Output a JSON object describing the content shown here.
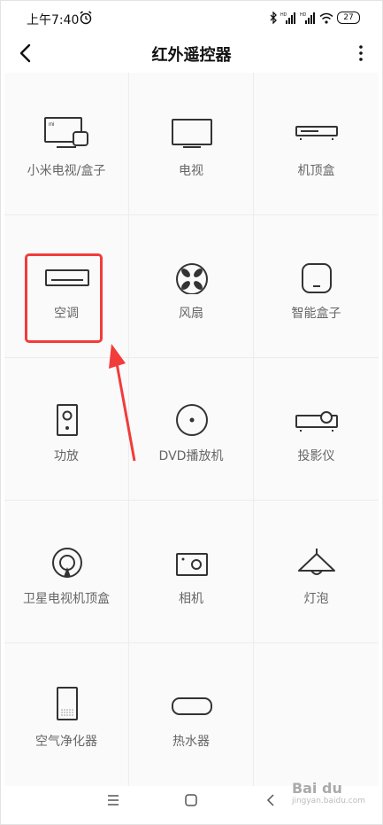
{
  "status_bar": {
    "time": "上午7:40",
    "battery": "27",
    "icons": [
      "alarm-icon",
      "bluetooth-icon",
      "hd-signal-icon",
      "hd-signal-icon",
      "wifi-icon",
      "battery-icon"
    ]
  },
  "header": {
    "title": "红外遥控器"
  },
  "devices": [
    {
      "label": "小米电视/盒子",
      "icon": "mi-tv-box-icon"
    },
    {
      "label": "电视",
      "icon": "tv-icon"
    },
    {
      "label": "机顶盒",
      "icon": "set-top-box-icon"
    },
    {
      "label": "空调",
      "icon": "air-conditioner-icon"
    },
    {
      "label": "风扇",
      "icon": "fan-icon"
    },
    {
      "label": "智能盒子",
      "icon": "smart-box-icon"
    },
    {
      "label": "功放",
      "icon": "amplifier-icon"
    },
    {
      "label": "DVD播放机",
      "icon": "dvd-player-icon"
    },
    {
      "label": "投影仪",
      "icon": "projector-icon"
    },
    {
      "label": "卫星电视机顶盒",
      "icon": "satellite-box-icon"
    },
    {
      "label": "相机",
      "icon": "camera-icon"
    },
    {
      "label": "灯泡",
      "icon": "lamp-icon"
    },
    {
      "label": "空气净化器",
      "icon": "air-purifier-icon"
    },
    {
      "label": "热水器",
      "icon": "water-heater-icon"
    }
  ],
  "colors": {
    "highlight": "#f23b3b",
    "icon_stroke": "#333333",
    "label": "#666666"
  },
  "watermark": {
    "text": "Bai du",
    "sub": "jingyan.baidu.com"
  }
}
